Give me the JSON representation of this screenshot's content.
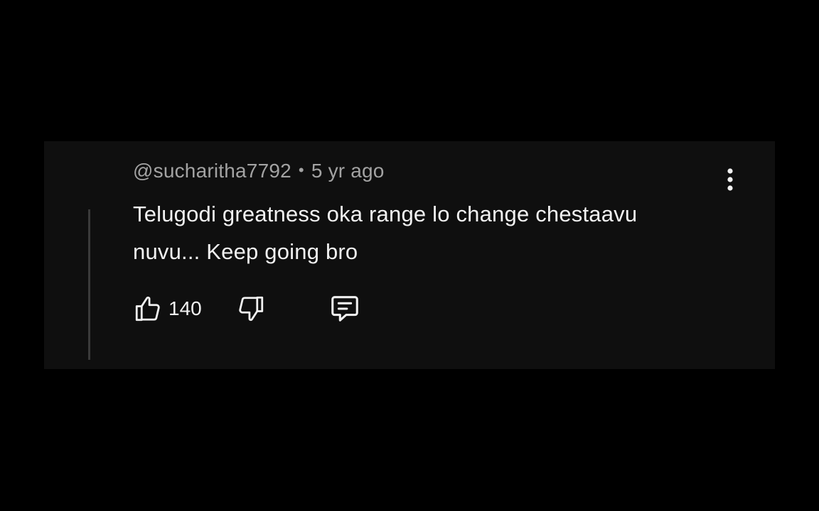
{
  "comment": {
    "author": "@sucharitha7792",
    "separator": "•",
    "age": "5 yr ago",
    "text": "Telugodi greatness oka range lo change chestaavu nuvu... Keep going bro",
    "like_count": "140"
  },
  "icons": {
    "more": "more-vertical-icon",
    "like": "thumbs-up-icon",
    "dislike": "thumbs-down-icon",
    "reply": "comment-icon"
  },
  "colors": {
    "background": "#000000",
    "card": "#0f0f0f",
    "primary_text": "#f1f1f1",
    "secondary_text": "#a3a3a3",
    "thread_line": "#3a3a3a"
  }
}
